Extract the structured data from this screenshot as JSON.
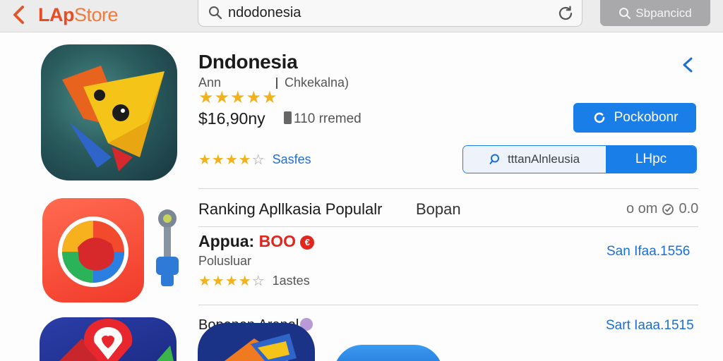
{
  "header": {
    "brand_part1": "LAp",
    "brand_part2": "Store",
    "search_value": "ndodonesia",
    "search_button_label": "Sbpancicd"
  },
  "featured": {
    "title": "Dndonesia",
    "developer": "Ann",
    "category": "Chkekalna)",
    "stars_filled": 5,
    "price": "$16,90ny",
    "meta": "110 rremed",
    "rating_stars_filled": 4,
    "rating_label": "Sasfes",
    "primary_button_label": "Pockobonr",
    "segment_left_label": "tttanAlnleusia",
    "segment_right_label": "LHpc"
  },
  "ranking": {
    "title": "Ranking Apllkasia Populalr",
    "side_label": "Bopan",
    "right_label": "o om",
    "right_value": "0.0"
  },
  "app_item": {
    "name_prefix": "Appua:",
    "name_highlight": "BOO",
    "badge": "€",
    "subtitle": "Polusluar",
    "stars_filled": 4,
    "stars_label": "1astes",
    "link_label": "San Ifaa.1556"
  },
  "third_item": {
    "title": "Bopenen Aranal",
    "link_label": "Sart Iaaa.1515"
  },
  "colors": {
    "accent_blue": "#1a7ee8",
    "brand_orange": "#e74c22",
    "star_gold": "#f2b21d"
  }
}
